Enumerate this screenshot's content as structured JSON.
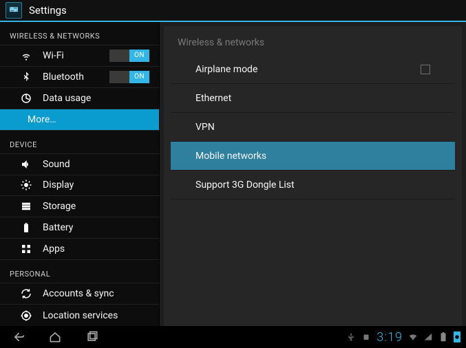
{
  "appbar": {
    "title": "Settings"
  },
  "sidebar": {
    "sections": {
      "wireless": {
        "header": "WIRELESS & NETWORKS",
        "items": [
          {
            "icon": "wifi",
            "label": "Wi-Fi",
            "toggle": "ON"
          },
          {
            "icon": "bluetooth",
            "label": "Bluetooth",
            "toggle": "ON"
          },
          {
            "icon": "datausage",
            "label": "Data usage"
          },
          {
            "icon": "",
            "label": "More…",
            "selected": true
          }
        ]
      },
      "device": {
        "header": "DEVICE",
        "items": [
          {
            "icon": "sound",
            "label": "Sound"
          },
          {
            "icon": "display",
            "label": "Display"
          },
          {
            "icon": "storage",
            "label": "Storage"
          },
          {
            "icon": "battery",
            "label": "Battery"
          },
          {
            "icon": "apps",
            "label": "Apps"
          }
        ]
      },
      "personal": {
        "header": "PERSONAL",
        "items": [
          {
            "icon": "sync",
            "label": "Accounts & sync"
          },
          {
            "icon": "location",
            "label": "Location services"
          }
        ]
      }
    }
  },
  "panel": {
    "title": "Wireless & networks",
    "items": [
      {
        "label": "Airplane mode",
        "checkbox": true
      },
      {
        "label": "Ethernet"
      },
      {
        "label": "VPN"
      },
      {
        "label": "Mobile networks",
        "selected": true
      },
      {
        "label": "Support 3G Dongle List"
      }
    ]
  },
  "statusbar": {
    "clock": "3:19"
  }
}
